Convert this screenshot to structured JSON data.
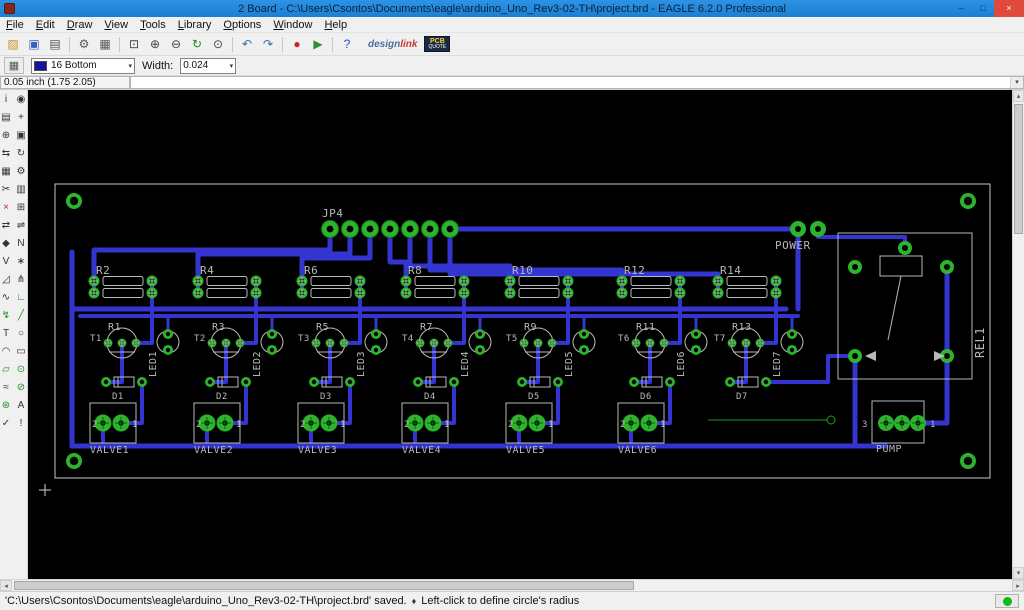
{
  "window": {
    "title": "2 Board - C:\\Users\\Csontos\\Documents\\eagle\\arduino_Uno_Rev3-02-TH\\project.brd - EAGLE 6.2.0 Professional",
    "controls": {
      "minimize": "–",
      "maximize": "□",
      "close": "×"
    }
  },
  "menu_items": [
    "File",
    "Edit",
    "Draw",
    "View",
    "Tools",
    "Library",
    "Options",
    "Window",
    "Help"
  ],
  "toolbar_icons": [
    {
      "name": "open-icon",
      "glyph": "▨",
      "color": "#c9972e"
    },
    {
      "name": "save-icon",
      "glyph": "▣",
      "color": "#3a5fbf"
    },
    {
      "name": "print-icon",
      "glyph": "▤",
      "color": "#555555"
    },
    {
      "name": "sep"
    },
    {
      "name": "cam-processor-icon",
      "glyph": "⚙",
      "color": "#555555"
    },
    {
      "name": "board-schematic-icon",
      "glyph": "▦",
      "color": "#555555"
    },
    {
      "name": "sep"
    },
    {
      "name": "zoom-fit-icon",
      "glyph": "⊡",
      "color": "#444444"
    },
    {
      "name": "zoom-in-icon",
      "glyph": "⊕",
      "color": "#444444"
    },
    {
      "name": "zoom-out-icon",
      "glyph": "⊖",
      "color": "#444444"
    },
    {
      "name": "zoom-redraw-icon",
      "glyph": "↻",
      "color": "#1e8f1e"
    },
    {
      "name": "zoom-select-icon",
      "glyph": "⊙",
      "color": "#444444"
    },
    {
      "name": "sep"
    },
    {
      "name": "undo-icon",
      "glyph": "↶",
      "color": "#2f6fb2"
    },
    {
      "name": "redo-icon",
      "glyph": "↷",
      "color": "#2f6fb2"
    },
    {
      "name": "sep"
    },
    {
      "name": "stop-icon",
      "glyph": "●",
      "color": "#cc2626"
    },
    {
      "name": "run-script-icon",
      "glyph": "▶",
      "color": "#2e8f2e"
    },
    {
      "name": "sep"
    },
    {
      "name": "help-icon",
      "glyph": "?",
      "color": "#2255cc"
    }
  ],
  "brand": {
    "design": "design",
    "link": "link",
    "pcb": "PCB",
    "quote": "QUOTE"
  },
  "layerbar": {
    "grid_glyph": "▦",
    "layer": "16 Bottom",
    "width_label": "Width:",
    "width": "0.024"
  },
  "ui": {
    "dropdown_arrow": "▾"
  },
  "coordinate_display": "0.05 inch (1.75 2.05)",
  "command_input": "",
  "palette_tools": [
    {
      "name": "info-tool-icon",
      "glyph": "i"
    },
    {
      "name": "show-tool-icon",
      "glyph": "◉"
    },
    {
      "name": "display-tool-icon",
      "glyph": "▤"
    },
    {
      "name": "mark-tool-icon",
      "glyph": "+"
    },
    {
      "name": "move-tool-icon",
      "glyph": "⊕"
    },
    {
      "name": "copy-tool-icon",
      "glyph": "▣"
    },
    {
      "name": "mirror-tool-icon",
      "glyph": "⇆"
    },
    {
      "name": "rotate-tool-icon",
      "glyph": "↻"
    },
    {
      "name": "group-tool-icon",
      "glyph": "▦"
    },
    {
      "name": "change-tool-icon",
      "glyph": "⚙"
    },
    {
      "name": "cut-tool-icon",
      "glyph": "✂"
    },
    {
      "name": "paste-tool-icon",
      "glyph": "▥"
    },
    {
      "name": "delete-tool-icon",
      "glyph": "×",
      "color": "#b03030"
    },
    {
      "name": "add-tool-icon",
      "glyph": "⊞"
    },
    {
      "name": "pinswap-tool-icon",
      "glyph": "⇄"
    },
    {
      "name": "replace-tool-icon",
      "glyph": "⇌"
    },
    {
      "name": "lock-tool-icon",
      "glyph": "◆"
    },
    {
      "name": "name-tool-icon",
      "glyph": "N"
    },
    {
      "name": "value-tool-icon",
      "glyph": "V"
    },
    {
      "name": "smash-tool-icon",
      "glyph": "∗"
    },
    {
      "name": "miter-tool-icon",
      "glyph": "◿"
    },
    {
      "name": "split-tool-icon",
      "glyph": "⋔"
    },
    {
      "name": "optimize-tool-icon",
      "glyph": "∿"
    },
    {
      "name": "route-tool-icon",
      "glyph": "∟",
      "color": "#1e8f1e"
    },
    {
      "name": "ripup-tool-icon",
      "glyph": "↯",
      "color": "#1e8f1e"
    },
    {
      "name": "wire-tool-icon",
      "glyph": "╱",
      "color": "#1e8f1e"
    },
    {
      "name": "text-tool-icon",
      "glyph": "T"
    },
    {
      "name": "circle-tool-icon",
      "glyph": "○"
    },
    {
      "name": "arc-tool-icon",
      "glyph": "◠"
    },
    {
      "name": "rect-tool-icon",
      "glyph": "▭"
    },
    {
      "name": "polygon-tool-icon",
      "glyph": "▱",
      "color": "#1e8f1e"
    },
    {
      "name": "via-tool-icon",
      "glyph": "⊙",
      "color": "#1e8f1e"
    },
    {
      "name": "signal-tool-icon",
      "glyph": "≈"
    },
    {
      "name": "hole-tool-icon",
      "glyph": "⊘",
      "color": "#1e8f1e"
    },
    {
      "name": "ratsnest-tool-icon",
      "glyph": "⊛",
      "color": "#1e8f1e"
    },
    {
      "name": "auto-tool-icon",
      "glyph": "A"
    },
    {
      "name": "drc-tool-icon",
      "glyph": "✓"
    },
    {
      "name": "errors-tool-icon",
      "glyph": "!"
    }
  ],
  "board": {
    "jp4": "JP4",
    "power": "POWER",
    "rel1": "REL1",
    "pump": {
      "label": "PUMP",
      "pin_left": "3",
      "pin_right": "1"
    },
    "colors": {
      "trace": "#3434cf",
      "pad": "#2db32d",
      "silk": "#b9b9b9"
    },
    "channels": [
      {
        "r_top": "R2",
        "r_bottom": "R1",
        "transistor": "T1",
        "led": "LED1",
        "diode": "D1",
        "valve": "VALVE1",
        "pin_left": "2",
        "pin_right": "1"
      },
      {
        "r_top": "R4",
        "r_bottom": "R3",
        "transistor": "T2",
        "led": "LED2",
        "diode": "D2",
        "valve": "VALVE2",
        "pin_left": "2",
        "pin_right": "1"
      },
      {
        "r_top": "R6",
        "r_bottom": "R5",
        "transistor": "T3",
        "led": "LED3",
        "diode": "D3",
        "valve": "VALVE3",
        "pin_left": "2",
        "pin_right": "1"
      },
      {
        "r_top": "R8",
        "r_bottom": "R7",
        "transistor": "T4",
        "led": "LED4",
        "diode": "D4",
        "valve": "VALVE4",
        "pin_left": "2",
        "pin_right": "1"
      },
      {
        "r_top": "R10",
        "r_bottom": "R9",
        "transistor": "T5",
        "led": "LED5",
        "diode": "D5",
        "valve": "VALVE5",
        "pin_left": "2",
        "pin_right": "1"
      },
      {
        "r_top": "R12",
        "r_bottom": "R11",
        "transistor": "T6",
        "led": "LED6",
        "diode": "D6",
        "valve": "VALVE6",
        "pin_left": "2",
        "pin_right": "1"
      },
      {
        "r_top": "R14",
        "r_bottom": "R13",
        "transistor": "T7",
        "led": "LED7",
        "diode": "D7",
        "valve": null,
        "pin_left": "",
        "pin_right": ""
      }
    ]
  },
  "scrollbars": {
    "up": "▴",
    "down": "▾",
    "left": "◂",
    "right": "▸"
  },
  "statusbar": {
    "message": "'C:\\Users\\Csontos\\Documents\\eagle\\arduino_Uno_Rev3-02-TH\\project.brd' saved.",
    "separator": "♦",
    "hint": "Left-click to define circle's radius"
  }
}
